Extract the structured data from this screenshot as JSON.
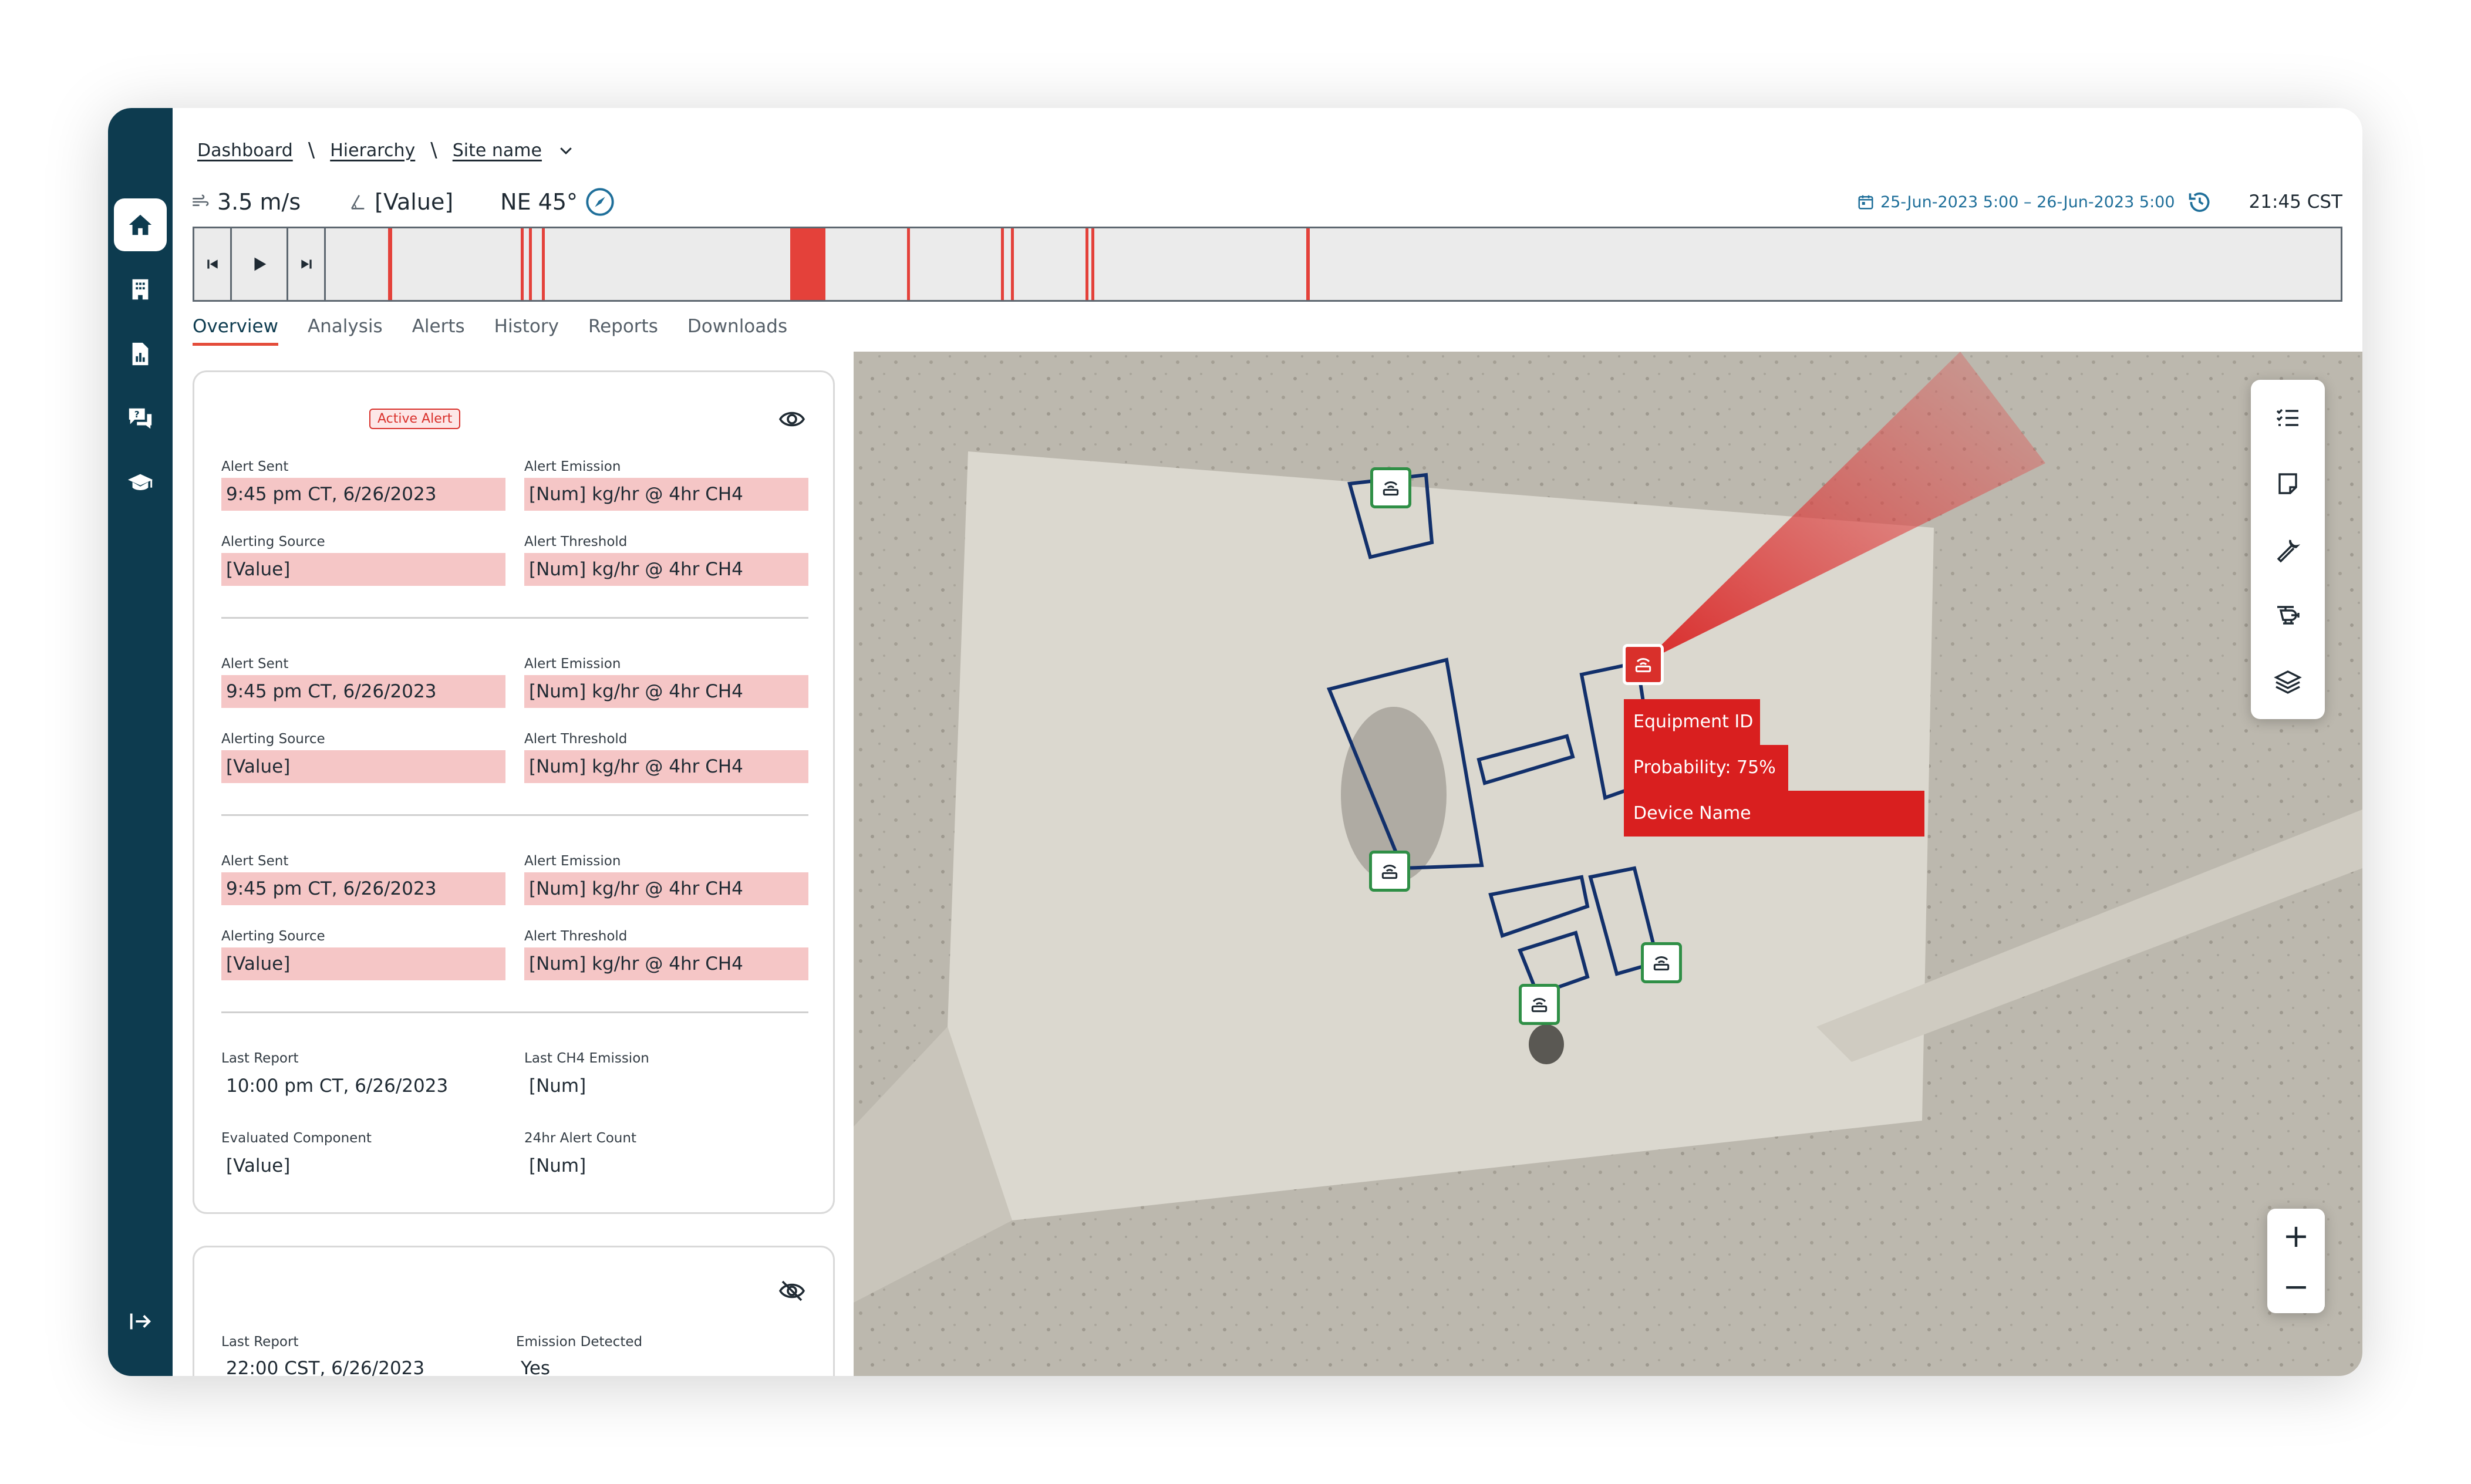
{
  "breadcrumb": {
    "items": [
      "Dashboard",
      "Hierarchy",
      "Site name"
    ]
  },
  "metrics": {
    "wind_speed": "3.5 m/s",
    "value": "[Value]",
    "direction": "NE 45°"
  },
  "date_range": "25-Jun-2023 5:00 – 26-Jun-2023 5:00",
  "clock": "21:45 CST",
  "timeline": {
    "alert_color": "#e4413a",
    "marks": [
      {
        "pos": 0.0315,
        "width": 0.002
      },
      {
        "pos": 0.0973,
        "width": 0.0015
      },
      {
        "pos": 0.1013,
        "width": 0.0015
      },
      {
        "pos": 0.1077,
        "width": 0.0015
      },
      {
        "pos": 0.231,
        "width": 0.0175
      },
      {
        "pos": 0.2888,
        "width": 0.0015
      },
      {
        "pos": 0.3355,
        "width": 0.0015
      },
      {
        "pos": 0.3403,
        "width": 0.0015
      },
      {
        "pos": 0.3773,
        "width": 0.0015
      },
      {
        "pos": 0.3803,
        "width": 0.0015
      },
      {
        "pos": 0.487,
        "width": 0.0016
      }
    ]
  },
  "tabs": [
    "Overview",
    "Analysis",
    "Alerts",
    "History",
    "Reports",
    "Downloads"
  ],
  "card1": {
    "badge": "Active Alert",
    "alerts": [
      {
        "sent_label": "Alert Sent",
        "sent": "9:45 pm CT, 6/26/2023",
        "emission_label": "Alert Emission",
        "emission": "[Num] kg/hr @ 4hr CH4",
        "source_label": "Alerting Source",
        "source": "[Value]",
        "threshold_label": "Alert Threshold",
        "threshold": "[Num] kg/hr @ 4hr CH4"
      },
      {
        "sent_label": "Alert Sent",
        "sent": "9:45 pm CT, 6/26/2023",
        "emission_label": "Alert Emission",
        "emission": "[Num] kg/hr @ 4hr CH4",
        "source_label": "Alerting Source",
        "source": "[Value]",
        "threshold_label": "Alert Threshold",
        "threshold": "[Num] kg/hr @ 4hr CH4"
      },
      {
        "sent_label": "Alert Sent",
        "sent": "9:45 pm CT, 6/26/2023",
        "emission_label": "Alert Emission",
        "emission": "[Num] kg/hr @ 4hr CH4",
        "source_label": "Alerting Source",
        "source": "[Value]",
        "threshold_label": "Alert Threshold",
        "threshold": "[Num] kg/hr @ 4hr CH4"
      }
    ],
    "summary": {
      "last_report_label": "Last Report",
      "last_report": "10:00 pm CT, 6/26/2023",
      "last_ch4_label": "Last CH4 Emission",
      "last_ch4": "[Num]",
      "component_label": "Evaluated Component",
      "component": "[Value]",
      "count_label": "24hr Alert Count",
      "count": "[Num]"
    }
  },
  "card2": {
    "last_report_label": "Last Report",
    "last_report": "22:00 CST, 6/26/2023",
    "emission_label": "Emission Detected",
    "emission": "Yes"
  },
  "tooltip": {
    "equipment": "Equipment ID",
    "probability": "Probability: 75%",
    "device": "Device Name"
  },
  "zoom": {
    "in": "+",
    "out": "−"
  },
  "icons": {
    "sidebar": [
      "home-icon",
      "building-icon",
      "report-icon",
      "help-chat-icon",
      "graduation-cap-icon",
      "collapse-sidebar-icon"
    ],
    "tools": [
      "checklist-icon",
      "note-icon",
      "wrench-icon",
      "helicopter-icon",
      "layers-icon"
    ]
  },
  "colors": {
    "sidebar": "#0d3b4f",
    "accent": "#e44c3a",
    "alert_fill": "#f5c6c6",
    "sensor_ok": "#2f8f46",
    "sensor_alert": "#d9302b",
    "equipment_outline": "#12306b"
  }
}
